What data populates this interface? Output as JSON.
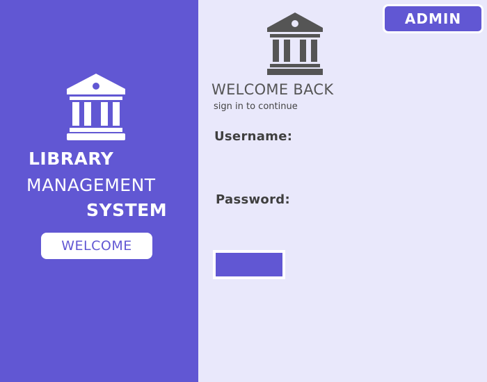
{
  "sidebar": {
    "title_line1": "LIBRARY",
    "title_line2": "MANAGEMENT",
    "title_line3": "SYSTEM",
    "welcome_button": "WELCOME",
    "logo_icon": "library-building-icon"
  },
  "header": {
    "admin_button": "ADMIN"
  },
  "login": {
    "logo_icon": "library-building-icon",
    "heading": "WELCOME BACK",
    "subheading": "sign in to continue",
    "username_label": "Username:",
    "username_value": "",
    "password_label": "Password:",
    "password_value": "",
    "submit_label": ""
  },
  "colors": {
    "accent": "#6157d3",
    "panel_background": "#e9e8fb",
    "icon_dark": "#555555",
    "white": "#ffffff"
  }
}
